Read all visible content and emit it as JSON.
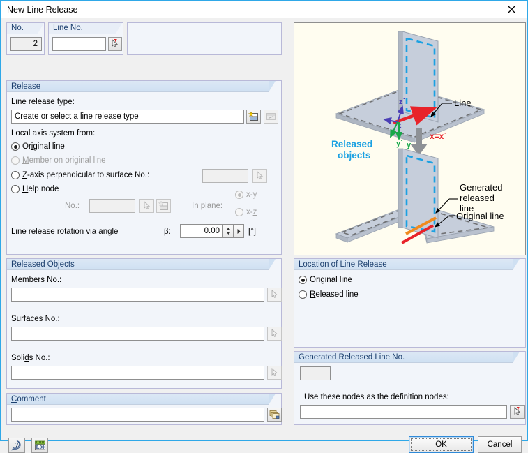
{
  "window": {
    "title": "New Line Release",
    "close_label": "×"
  },
  "header": {
    "no_label": "No.",
    "no_value": "2",
    "line_no_label": "Line No.",
    "line_no_value": "",
    "pick_line_icon": "pick-cursor-icon"
  },
  "release_group": {
    "title": "Release",
    "line_release_type_label": "Line release type:",
    "line_release_type_value": "Create or select a line release type",
    "new_type_icon": "new-window-icon",
    "edit_type_icon": "edit-window-icon",
    "local_axis_label": "Local axis system from:",
    "options": [
      {
        "label": "Original line",
        "underline": "i",
        "selected": true,
        "enabled": true
      },
      {
        "label": "Member on original line",
        "underline": "M",
        "selected": false,
        "enabled": false
      },
      {
        "label": "Z-axis perpendicular to surface No.:",
        "underline": "Z",
        "selected": false,
        "enabled": true
      },
      {
        "label": "Help node",
        "underline": "H",
        "selected": false,
        "enabled": true
      }
    ],
    "surface_no_value": "",
    "surface_pick_icon": "pick-cursor-icon",
    "help_node_no_label": "No.:",
    "help_node_no_value": "",
    "help_node_pick_icon": "pick-cursor-icon",
    "help_node_new_icon": "new-window-icon",
    "in_plane_label": "In plane:",
    "in_plane_options": [
      {
        "label": "x-y",
        "underline": "y",
        "selected": true
      },
      {
        "label": "x-z",
        "underline": "z",
        "selected": false
      }
    ],
    "rotation_label": "Line release rotation via angle",
    "beta_symbol": "β:",
    "beta_value": "0.00",
    "beta_unit": "[°]"
  },
  "released_objects": {
    "title": "Released Objects",
    "fields": [
      {
        "label": "Members No.:",
        "underline": "b",
        "value": "",
        "icon": "pick-cursor-icon"
      },
      {
        "label": "Surfaces No.:",
        "underline": "S",
        "value": "",
        "icon": "pick-cursor-icon"
      },
      {
        "label": "Solids No.:",
        "underline": "d",
        "value": "",
        "icon": "pick-cursor-icon"
      }
    ]
  },
  "comment": {
    "title": "Comment",
    "value": "",
    "library_icon": "comment-library-icon"
  },
  "illustration": {
    "alt": "line-release-diagram",
    "labels": {
      "line": "Line",
      "released_objects": "Released\nobjects",
      "x_axis": "x=x˙",
      "z_prime": "z˙",
      "z": "z",
      "y_prime": "y˙",
      "y": "y",
      "generated_released_line": "Generated\nreleased\nline",
      "original_line": "Original line"
    },
    "colors": {
      "background": "#fffdf0",
      "surface": "#c6cedb",
      "dashed_outline": "#6f7072",
      "released_blue": "#1ba1e2",
      "line_red": "#e8232a",
      "generated_orange": "#f08a1e",
      "axis_green": "#17a84a",
      "axis_violet": "#4b3fb5"
    }
  },
  "location_group": {
    "title": "Location of Line Release",
    "options": [
      {
        "label": "Original line",
        "underline": "g",
        "selected": true
      },
      {
        "label": "Released line",
        "underline": "R",
        "selected": false
      }
    ]
  },
  "generated_group": {
    "title": "Generated Released Line No.",
    "number_value": "",
    "definition_nodes_label": "Use these nodes as the definition nodes:",
    "definition_nodes_value": "",
    "pick_icon": "pick-cursor-icon"
  },
  "footer": {
    "help_icon": "help-question-icon",
    "units_icon": "units-0.00-icon",
    "units_text": "0.00",
    "ok_label": "OK",
    "cancel_label": "Cancel"
  }
}
